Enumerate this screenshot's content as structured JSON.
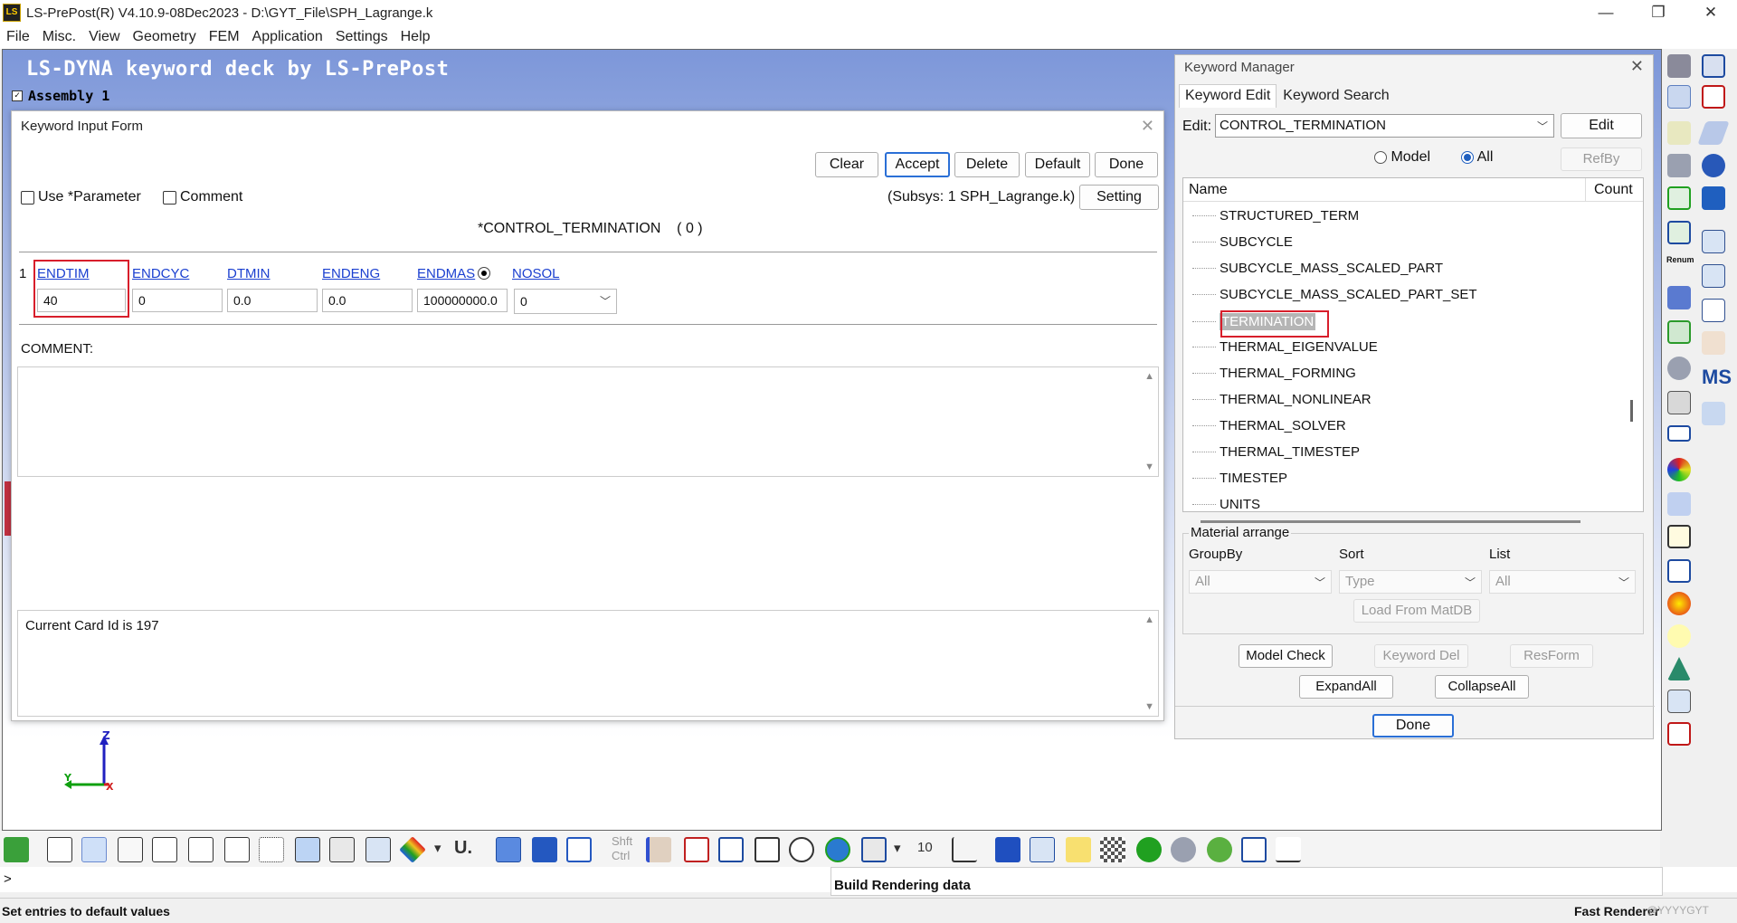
{
  "window": {
    "title": "LS-PrePost(R) V4.10.9-08Dec2023 - D:\\GYT_File\\SPH_Lagrange.k",
    "app_icon": "LS",
    "controls": [
      "—",
      "❐",
      "✕"
    ]
  },
  "menu": [
    "File",
    "Misc.",
    "View",
    "Geometry",
    "FEM",
    "Application",
    "Settings",
    "Help"
  ],
  "viewport": {
    "title": "LS-DYNA keyword deck by LS-PrePost",
    "assembly_label": "Assembly 1",
    "axes": {
      "z": "Z",
      "y": "Y",
      "x": "X"
    }
  },
  "keyword_input_form": {
    "title": "Keyword Input Form",
    "buttons": {
      "clear": "Clear",
      "accept": "Accept",
      "delete": "Delete",
      "default": "Default",
      "done": "Done",
      "setting": "Setting"
    },
    "use_parameter_label": "Use *Parameter",
    "comment_checkbox_label": "Comment",
    "subsys": "(Subsys: 1 SPH_Lagrange.k)",
    "keyword_title": "*CONTROL_TERMINATION    ( 0 )",
    "row_number": "1",
    "fields": [
      {
        "label": "ENDTIM",
        "value": "40"
      },
      {
        "label": "ENDCYC",
        "value": "0"
      },
      {
        "label": "DTMIN",
        "value": "0.0"
      },
      {
        "label": "ENDENG",
        "value": "0.0"
      },
      {
        "label": "ENDMAS",
        "value": "100000000.0"
      },
      {
        "label": "NOSOL",
        "value": "0"
      }
    ],
    "comment_label": "COMMENT:",
    "status_text": "Current Card Id is 197"
  },
  "keyword_manager": {
    "title": "Keyword Manager",
    "tabs": [
      "Keyword Edit",
      "Keyword Search"
    ],
    "edit_label": "Edit:",
    "edit_value": "CONTROL_TERMINATION",
    "edit_button": "Edit",
    "radio_model": "Model",
    "radio_all": "All",
    "refby_button": "RefBy",
    "tree_header": {
      "name": "Name",
      "count": "Count"
    },
    "tree_items": [
      "STRUCTURED_TERM",
      "SUBCYCLE",
      "SUBCYCLE_MASS_SCALED_PART",
      "SUBCYCLE_MASS_SCALED_PART_SET",
      "TERMINATION",
      "THERMAL_EIGENVALUE",
      "THERMAL_FORMING",
      "THERMAL_NONLINEAR",
      "THERMAL_SOLVER",
      "THERMAL_TIMESTEP",
      "TIMESTEP",
      "UNITS"
    ],
    "selected_item": "TERMINATION",
    "material_arrange": "Material arrange",
    "groupby_label": "GroupBy",
    "sort_label": "Sort",
    "list_label": "List",
    "groupby_value": "All",
    "sort_value": "Type",
    "list_value": "All",
    "load_matdb": "Load From MatDB",
    "model_check": "Model Check",
    "keyword_del": "Keyword Del",
    "resform": "ResForm",
    "expand_all": "ExpandAll",
    "collapse_all": "CollapseAll",
    "done": "Done"
  },
  "right_toolbar": {
    "renum_label": "Renum",
    "ms_label": "MS"
  },
  "bottom_toolbar": {
    "u_label": "U.",
    "shft_label": "Shft",
    "ctrl_label": "Ctrl",
    "number": "10"
  },
  "command_prompt": ">",
  "message": "Build Rendering data",
  "status": {
    "left": "Set entries to default values",
    "right": "Fast Renderer",
    "watermark": "@YYYYGYT"
  },
  "colors": {
    "viewport_top": "#7d97d9",
    "accent_blue": "#2a6fd6",
    "highlight_red": "#d81e2b",
    "link_blue": "#1a3fd0"
  }
}
